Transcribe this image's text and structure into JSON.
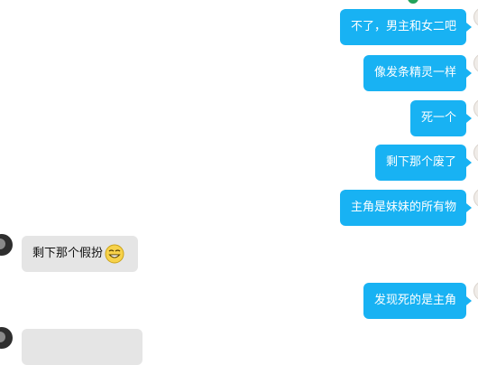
{
  "messages": [
    {
      "direction": "outgoing",
      "text": "不了，男主和女二吧"
    },
    {
      "direction": "outgoing",
      "text": "像发条精灵一样"
    },
    {
      "direction": "outgoing",
      "text": "死一个"
    },
    {
      "direction": "outgoing",
      "text": "剩下那个废了"
    },
    {
      "direction": "outgoing",
      "text": "主角是妹妹的所有物"
    },
    {
      "direction": "incoming",
      "text": "剩下那个假扮",
      "emoji": "grinning-face-emoji"
    },
    {
      "direction": "outgoing",
      "text": "发现死的是主角"
    }
  ],
  "colors": {
    "outgoing_bubble": "#18b2f3",
    "incoming_bubble": "#e5e5e5",
    "online_indicator": "#21a35a"
  }
}
